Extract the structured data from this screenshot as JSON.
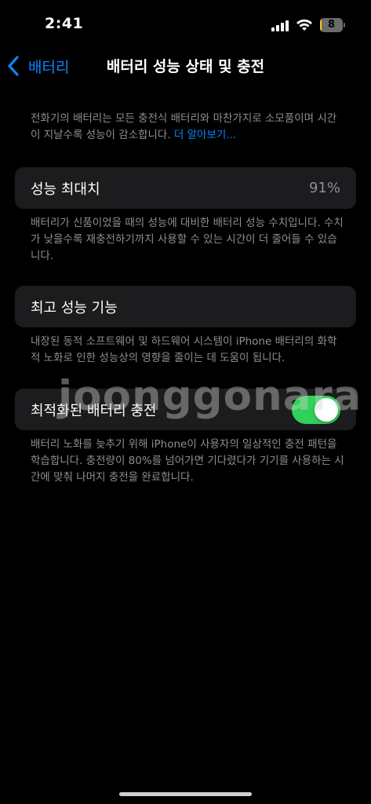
{
  "status_bar": {
    "time": "2:41",
    "battery_level": "8",
    "battery_fraction": 0.08,
    "battery_color": "#f5c518",
    "icons": [
      "signal-icon",
      "wifi-icon",
      "battery-icon"
    ]
  },
  "nav": {
    "back_label": "배터리",
    "title": "배터리 성능 상태 및 충전",
    "accent_color": "#0a84ff"
  },
  "intro": {
    "text": "전화기의 배터리는 모든 충전식 배터리와 마찬가지로 소모품이며 시간이 지날수록 성능이 감소합니다. ",
    "link": "더 알아보기..."
  },
  "max_capacity": {
    "label": "성능 최대치",
    "value": "91%",
    "description": "배터리가 신품이었을 때의 성능에 대비한 배터리 성능 수치입니다. 수치가 낮을수록 재충전하기까지 사용할 수 있는 시간이 더 줄어들 수 있습니다."
  },
  "peak_performance": {
    "label": "최고 성능 기능",
    "description": "내장된 동적 소프트웨어 및 하드웨어 시스템이 iPhone 배터리의 화학적 노화로 인한 성능상의 영향을 줄이는 데 도움이 됩니다."
  },
  "optimized_charging": {
    "label": "최적화된 배터리 충전",
    "enabled": true,
    "toggle_color": "#30d158",
    "description": "배터리 노화를 늦추기 위해 iPhone이 사용자의 일상적인 충전 패턴을 학습합니다. 충전량이 80%를 넘어가면 기다렸다가 기기를 사용하는 시간에 맞춰 나머지 충전을 완료합니다."
  },
  "watermark": "joonggonara"
}
